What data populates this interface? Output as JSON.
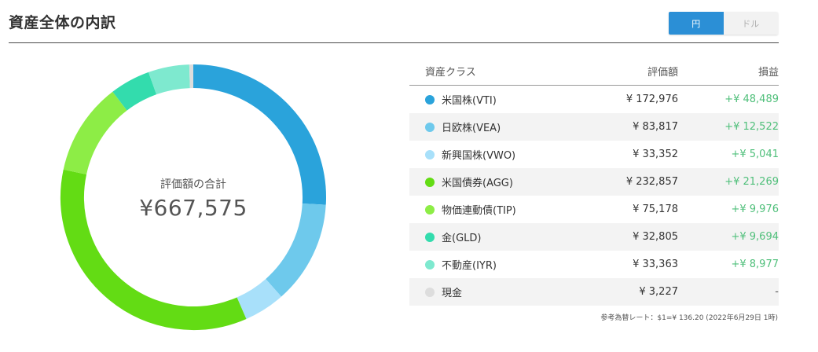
{
  "page": {
    "title": "資産全体の内訳"
  },
  "currency_toggle": {
    "yen_label": "円",
    "dollar_label": "ドル",
    "selected": "円"
  },
  "center": {
    "label": "評価額の合計",
    "total": "¥667,575"
  },
  "table": {
    "headers": {
      "asset_class": "資産クラス",
      "value": "評価額",
      "gain": "損益"
    },
    "rows": [
      {
        "name": "米国株(VTI)",
        "value": "¥ 172,976",
        "gain": "+¥ 48,489",
        "color": "#2aa3db"
      },
      {
        "name": "日欧株(VEA)",
        "value": "¥ 83,817",
        "gain": "+¥ 12,522",
        "color": "#6ec9ec"
      },
      {
        "name": "新興国株(VWO)",
        "value": "¥ 33,352",
        "gain": "+¥ 5,041",
        "color": "#a8e0fa"
      },
      {
        "name": "米国債券(AGG)",
        "value": "¥ 232,857",
        "gain": "+¥ 21,269",
        "color": "#63dc14"
      },
      {
        "name": "物価連動債(TIP)",
        "value": "¥ 75,178",
        "gain": "+¥ 9,976",
        "color": "#8ded46"
      },
      {
        "name": "金(GLD)",
        "value": "¥ 32,805",
        "gain": "+¥ 9,694",
        "color": "#33dcad"
      },
      {
        "name": "不動産(IYR)",
        "value": "¥ 33,363",
        "gain": "+¥ 8,977",
        "color": "#7ee9cf"
      },
      {
        "name": "現金",
        "value": "¥ 3,227",
        "gain": "-",
        "color": "#dddddd"
      }
    ]
  },
  "rate_note": "参考為替レート：$1=¥ 136.20 (2022年6月29日 1時)",
  "chart_data": {
    "type": "pie",
    "donut": true,
    "categories": [
      "米国株(VTI)",
      "日欧株(VEA)",
      "新興国株(VWO)",
      "米国債券(AGG)",
      "物価連動債(TIP)",
      "金(GLD)",
      "不動産(IYR)",
      "現金"
    ],
    "values": [
      172976,
      83817,
      33352,
      232857,
      75178,
      32805,
      33363,
      3227
    ],
    "colors": [
      "#2aa3db",
      "#6ec9ec",
      "#a8e0fa",
      "#63dc14",
      "#8ded46",
      "#33dcad",
      "#7ee9cf",
      "#dddddd"
    ],
    "total": 667575
  }
}
